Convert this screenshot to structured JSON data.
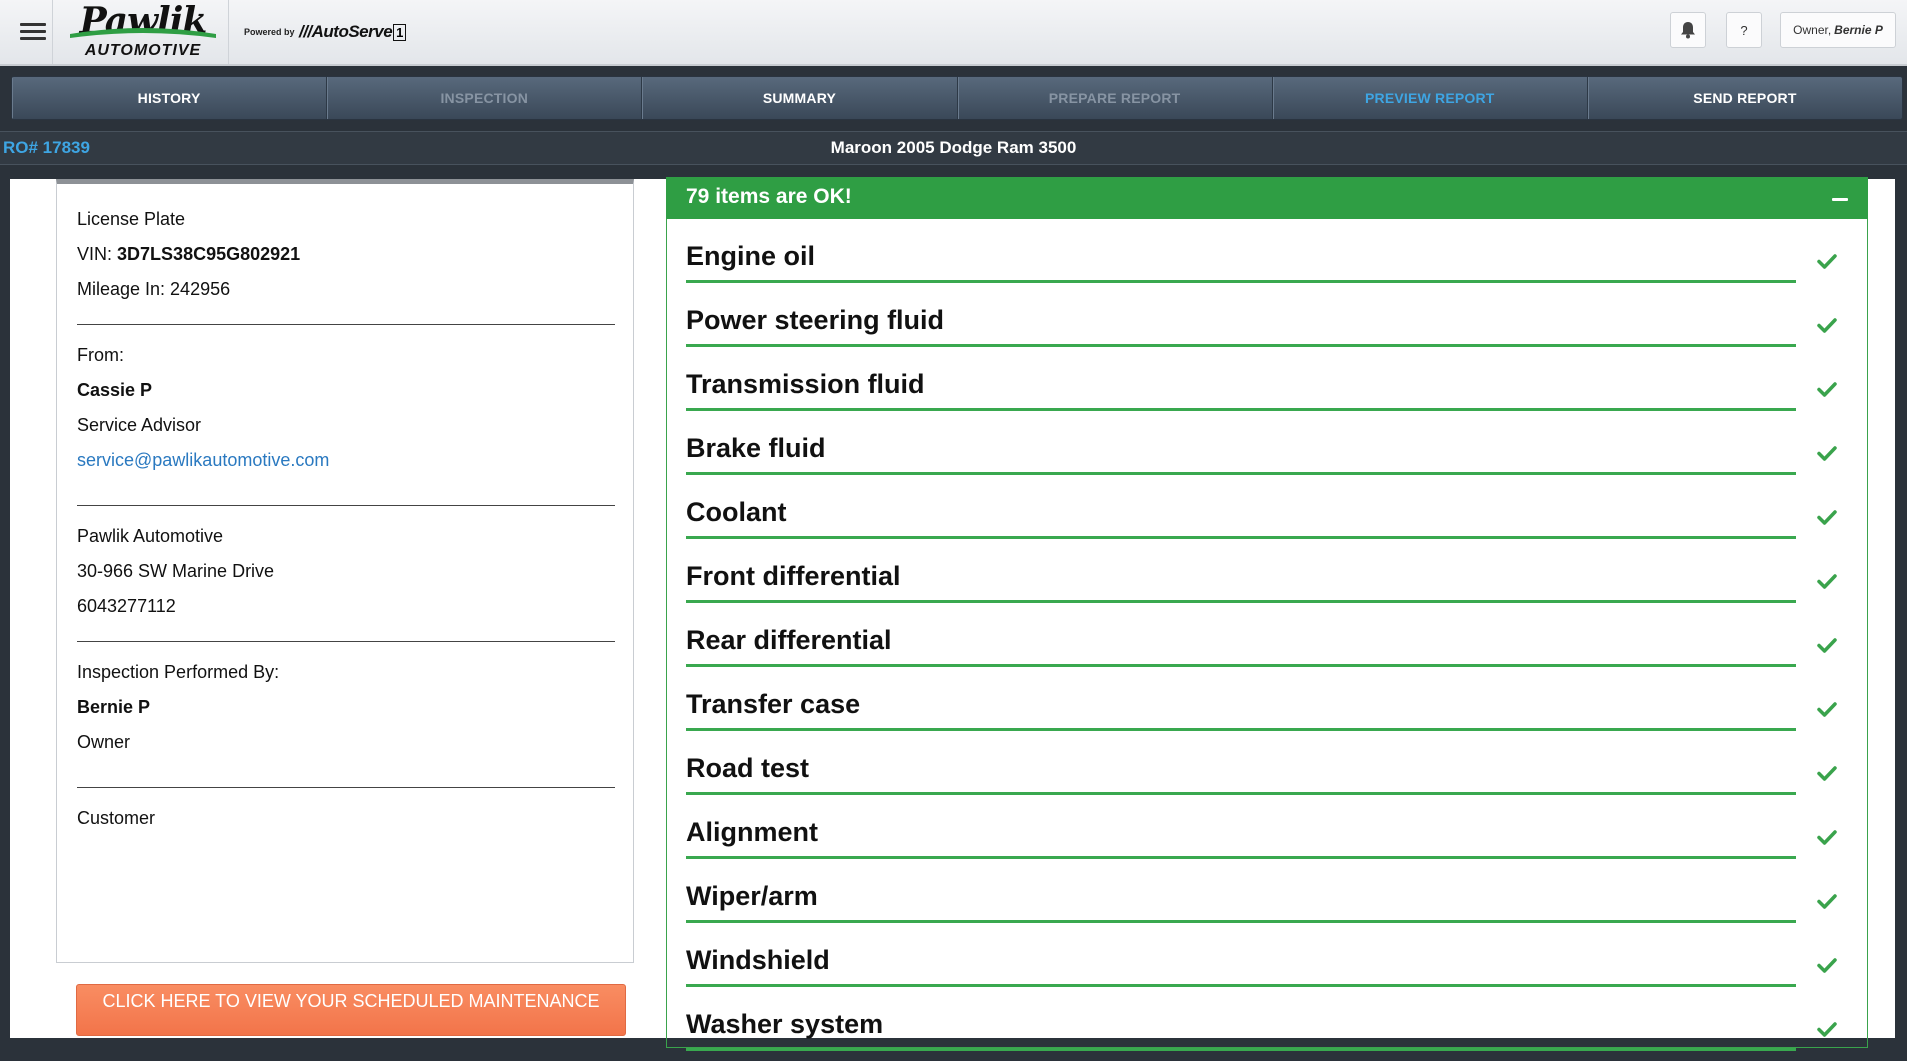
{
  "header": {
    "logo_name": "Pawlik",
    "logo_sub": "AUTOMOTIVE",
    "powered_by": "Powered by",
    "autoserve": "AutoServe",
    "autoserve_num": "1",
    "help_label": "?",
    "user_role": "Owner,",
    "user_name": "Bernie P"
  },
  "nav": {
    "tabs": [
      {
        "label": "HISTORY",
        "state": "normal"
      },
      {
        "label": "INSPECTION",
        "state": "disabled"
      },
      {
        "label": "SUMMARY",
        "state": "normal"
      },
      {
        "label": "PREPARE REPORT",
        "state": "disabled"
      },
      {
        "label": "PREVIEW REPORT",
        "state": "active"
      },
      {
        "label": "SEND REPORT",
        "state": "normal"
      }
    ]
  },
  "ro": {
    "number": "RO# 17839",
    "vehicle": "Maroon 2005 Dodge Ram 3500"
  },
  "left": {
    "license_plate": "License Plate",
    "vin_label": "VIN:",
    "vin": "3D7LS38C95G802921",
    "mileage": "Mileage In: 242956",
    "from_label": "From:",
    "from_name": "Cassie P",
    "from_role": "Service Advisor",
    "from_email": "service@pawlikautomotive.com",
    "shop_name": "Pawlik Automotive",
    "shop_address": "30-966 SW Marine Drive",
    "shop_phone": "6043277112",
    "inspector_label": "Inspection Performed By:",
    "inspector_name": "Bernie P",
    "inspector_role": "Owner",
    "customer_label": "Customer",
    "maintenance_button": "CLICK HERE TO VIEW YOUR SCHEDULED MAINTENANCE"
  },
  "ok_panel": {
    "title": "79 items are OK!",
    "items": [
      "Engine oil",
      "Power steering fluid",
      "Transmission fluid",
      "Brake fluid",
      "Coolant",
      "Front differential",
      "Rear differential",
      "Transfer case",
      "Road test",
      "Alignment",
      "Wiper/arm",
      "Windshield",
      "Washer system"
    ]
  },
  "colors": {
    "accent_blue": "#3ea5e3",
    "ok_green": "#2f9e44",
    "maintenance_orange": "#f2744a"
  }
}
